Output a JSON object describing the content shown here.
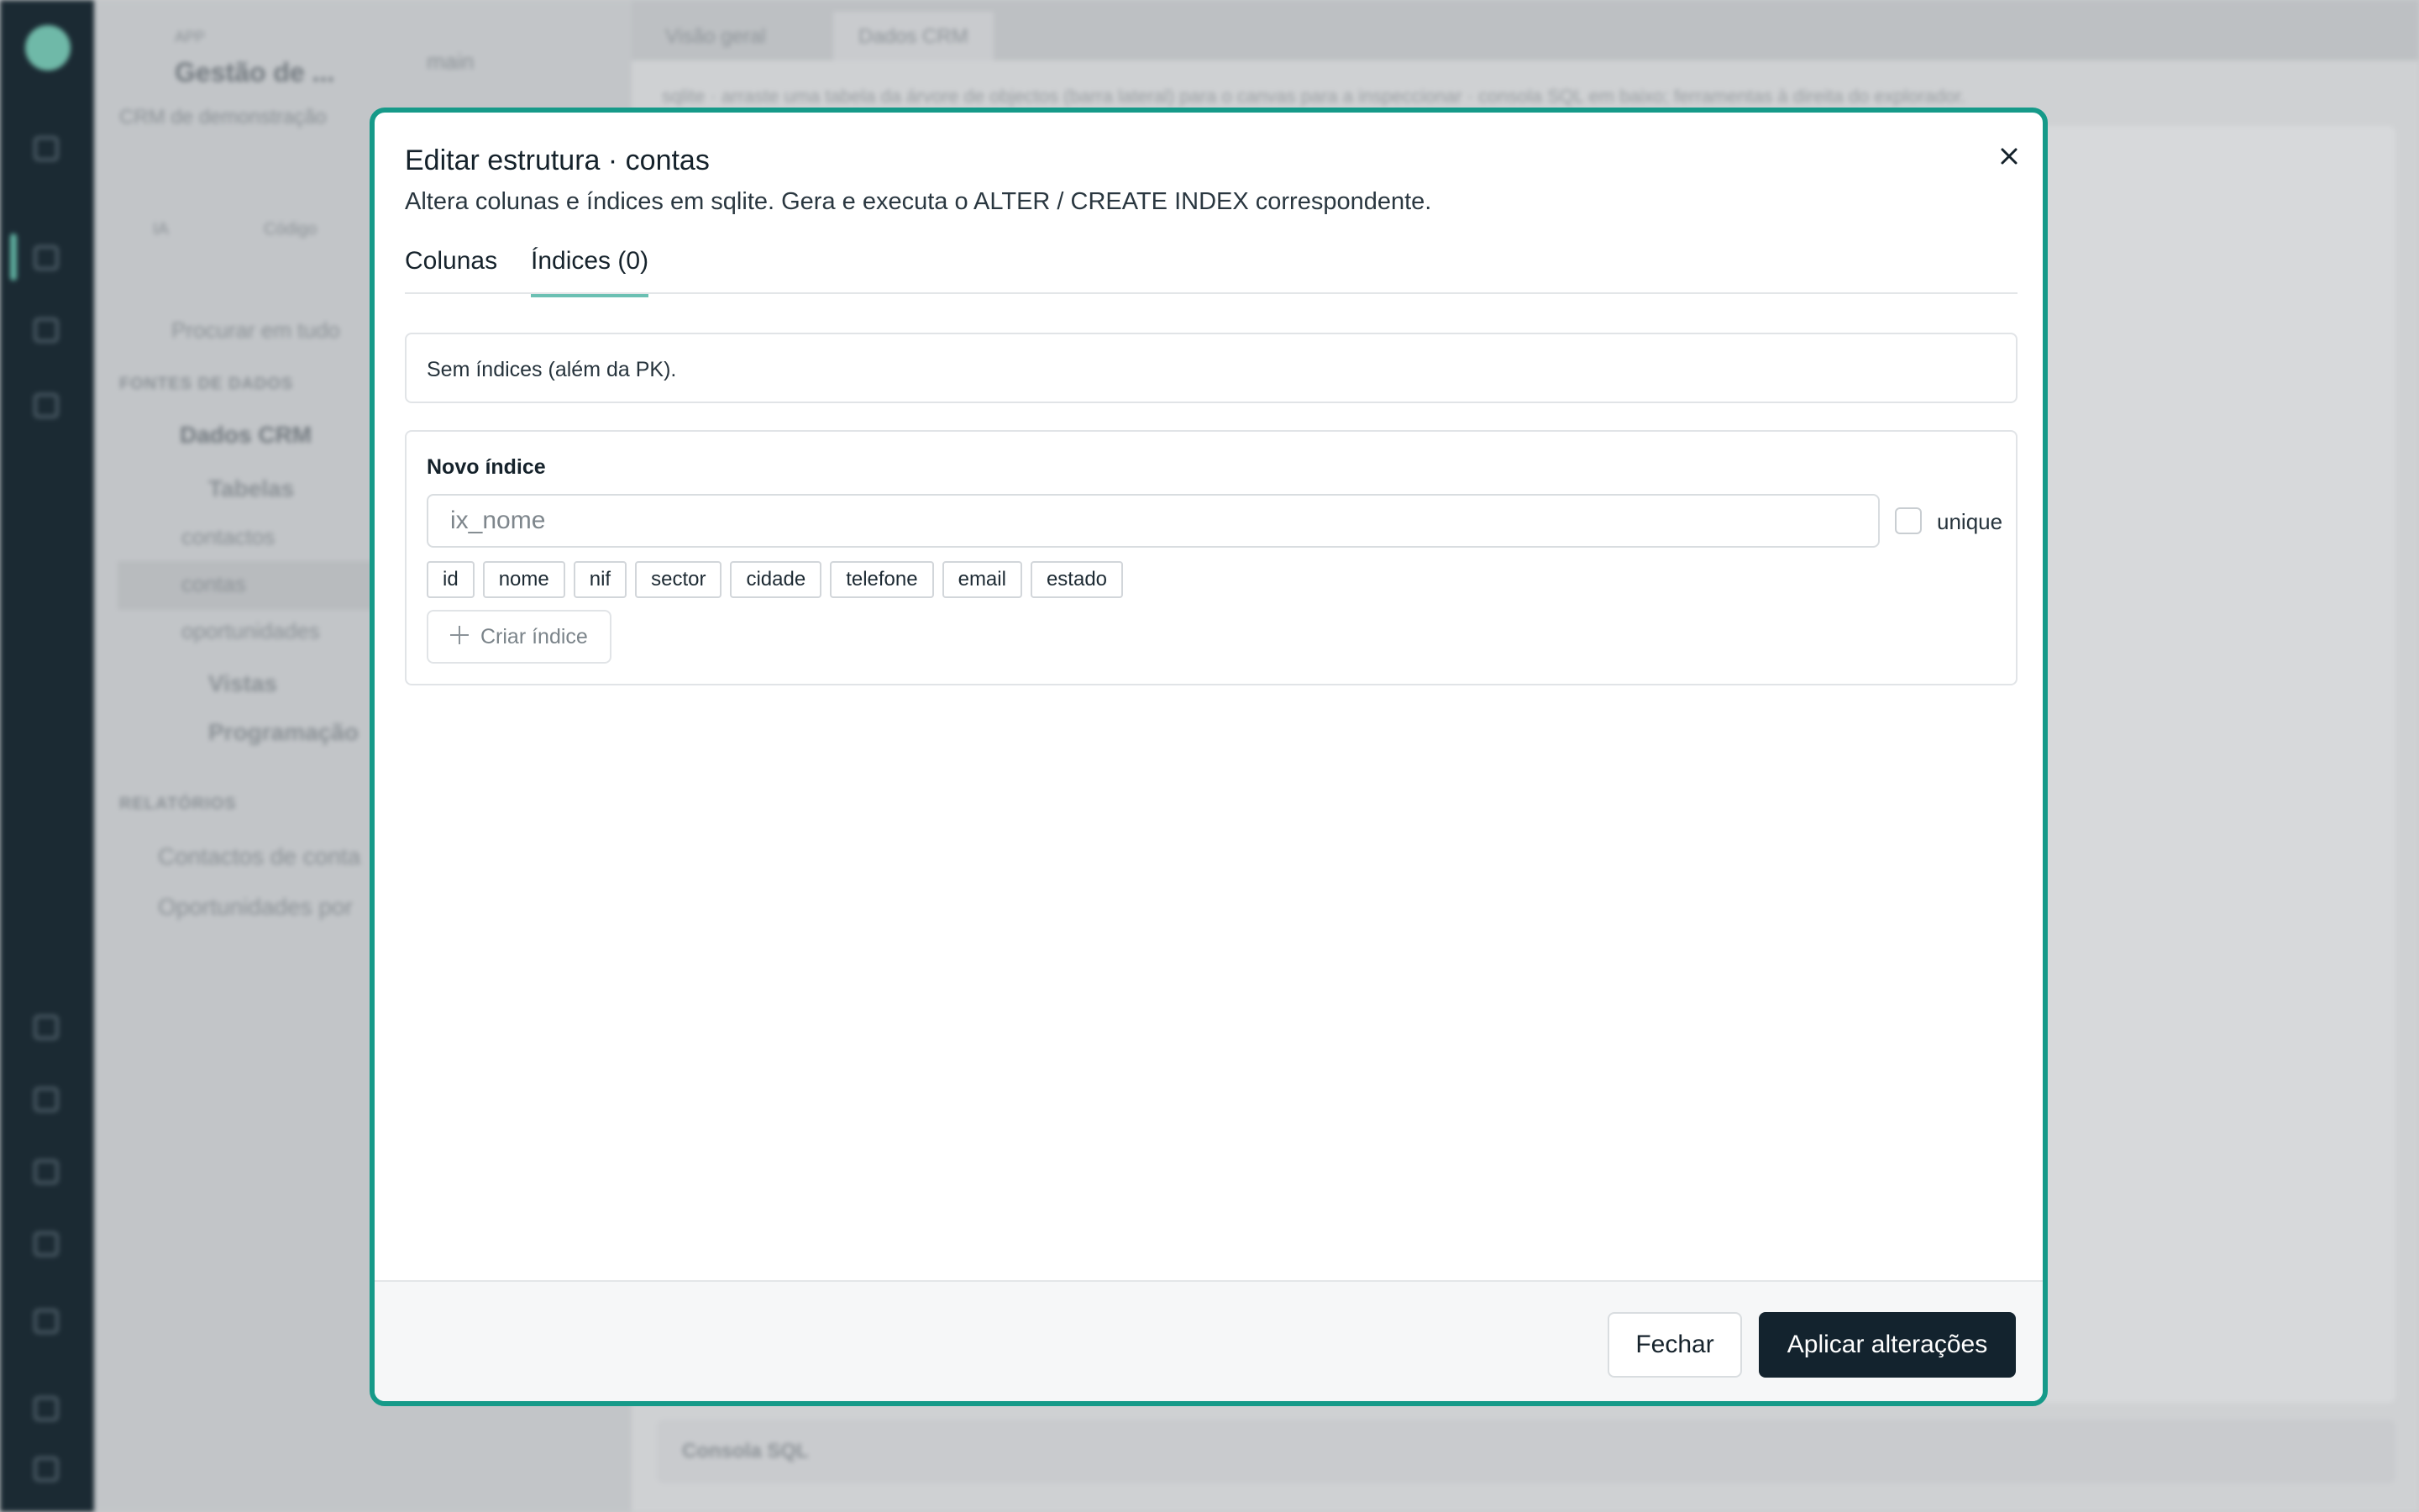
{
  "background": {
    "sidebar": {
      "project_kicker": "APP",
      "project_name": "Gestão de ...",
      "branch": "main",
      "project_sub": "CRM de demonstração",
      "quick_actions": [
        "IA",
        "Código"
      ],
      "search_placeholder": "Procurar em tudo",
      "section_datasources": "FONTES DE DADOS",
      "datasource": "Dados CRM",
      "folder_tables": "Tabelas",
      "tables": [
        "contactos",
        "contas",
        "oportunidades"
      ],
      "folder_views": "Vistas",
      "folder_programming": "Programação",
      "section_reports": "RELATÓRIOS",
      "reports": [
        "Contactos de conta",
        "Oportunidades por"
      ]
    },
    "tabs": [
      "Visão geral",
      "Dados CRM"
    ],
    "hint": "sqlite · arraste uma tabela da árvore de objectos (barra lateral) para o canvas para a inspeccionar · consola SQL em baixo; ferramentas à direita do explorador.",
    "console_label": "Consola SQL"
  },
  "modal": {
    "title": "Editar estrutura · contas",
    "subtitle": "Altera colunas e índices em sqlite. Gera e executa o ALTER / CREATE INDEX correspondente.",
    "tabs": [
      {
        "label": "Colunas",
        "active": false
      },
      {
        "label": "Índices (0)",
        "active": true
      }
    ],
    "empty_message": "Sem índices (além da PK).",
    "new_index": {
      "heading": "Novo índice",
      "name_value": "",
      "name_placeholder": "ix_nome",
      "unique_label": "unique",
      "unique_checked": false,
      "columns": [
        "id",
        "nome",
        "nif",
        "sector",
        "cidade",
        "telefone",
        "email",
        "estado"
      ],
      "create_label": "Criar índice",
      "create_icon": "plus-icon"
    },
    "footer": {
      "close_label": "Fechar",
      "apply_label": "Aplicar alterações"
    }
  },
  "colors": {
    "accent": "#169a89",
    "primary_button": "#13232e",
    "rail": "#1b2a33"
  }
}
